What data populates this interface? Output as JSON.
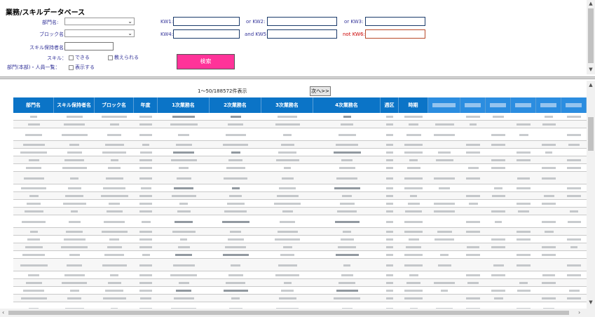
{
  "page": {
    "title": "業務/スキルデータベース"
  },
  "form": {
    "dept_label": "部門名:",
    "block_label": "ブロック名:",
    "skill_holder_label": "スキル保持者名:",
    "skill_label": "スキル：",
    "skill_opt1": "できる",
    "skill_opt2": "教えられる",
    "dept_member_label": "部門(本部)・人員一覧：",
    "display_opt": "表示する",
    "kw1_label": "KW1:",
    "kw2_label": "or KW2:",
    "kw3_label": "or KW3:",
    "kw4_label": "KW4:",
    "kw5_label": "and KW5:",
    "kw6_label": "not KW6:",
    "search_button": "検索"
  },
  "results": {
    "count_text": "1～50/188572件表示",
    "next_button": "次へ>>",
    "columns": [
      "部門名",
      "スキル保持者名",
      "ブロック名",
      "年度",
      "1次業務名",
      "2次業務名",
      "3次業務名",
      "4次業務名",
      "週区",
      "時期",
      "",
      "",
      "",
      "",
      "",
      "",
      "DB登録日"
    ]
  },
  "colors": {
    "header_bg": "#0b74c7",
    "search_button_bg": "#ff3399"
  }
}
